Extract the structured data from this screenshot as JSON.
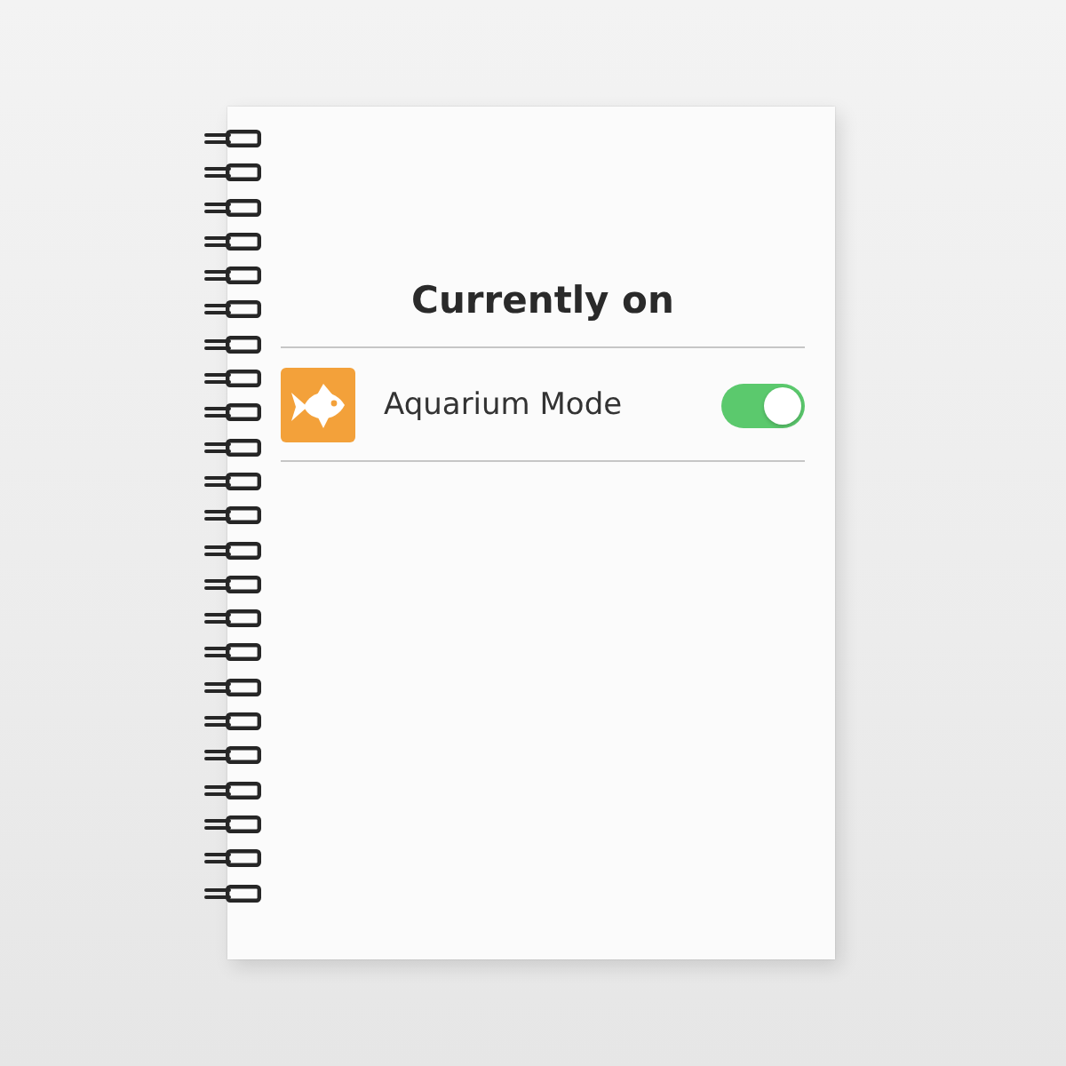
{
  "title": "Currently on",
  "settings": [
    {
      "label": "Aquarium Mode",
      "on": true
    }
  ]
}
